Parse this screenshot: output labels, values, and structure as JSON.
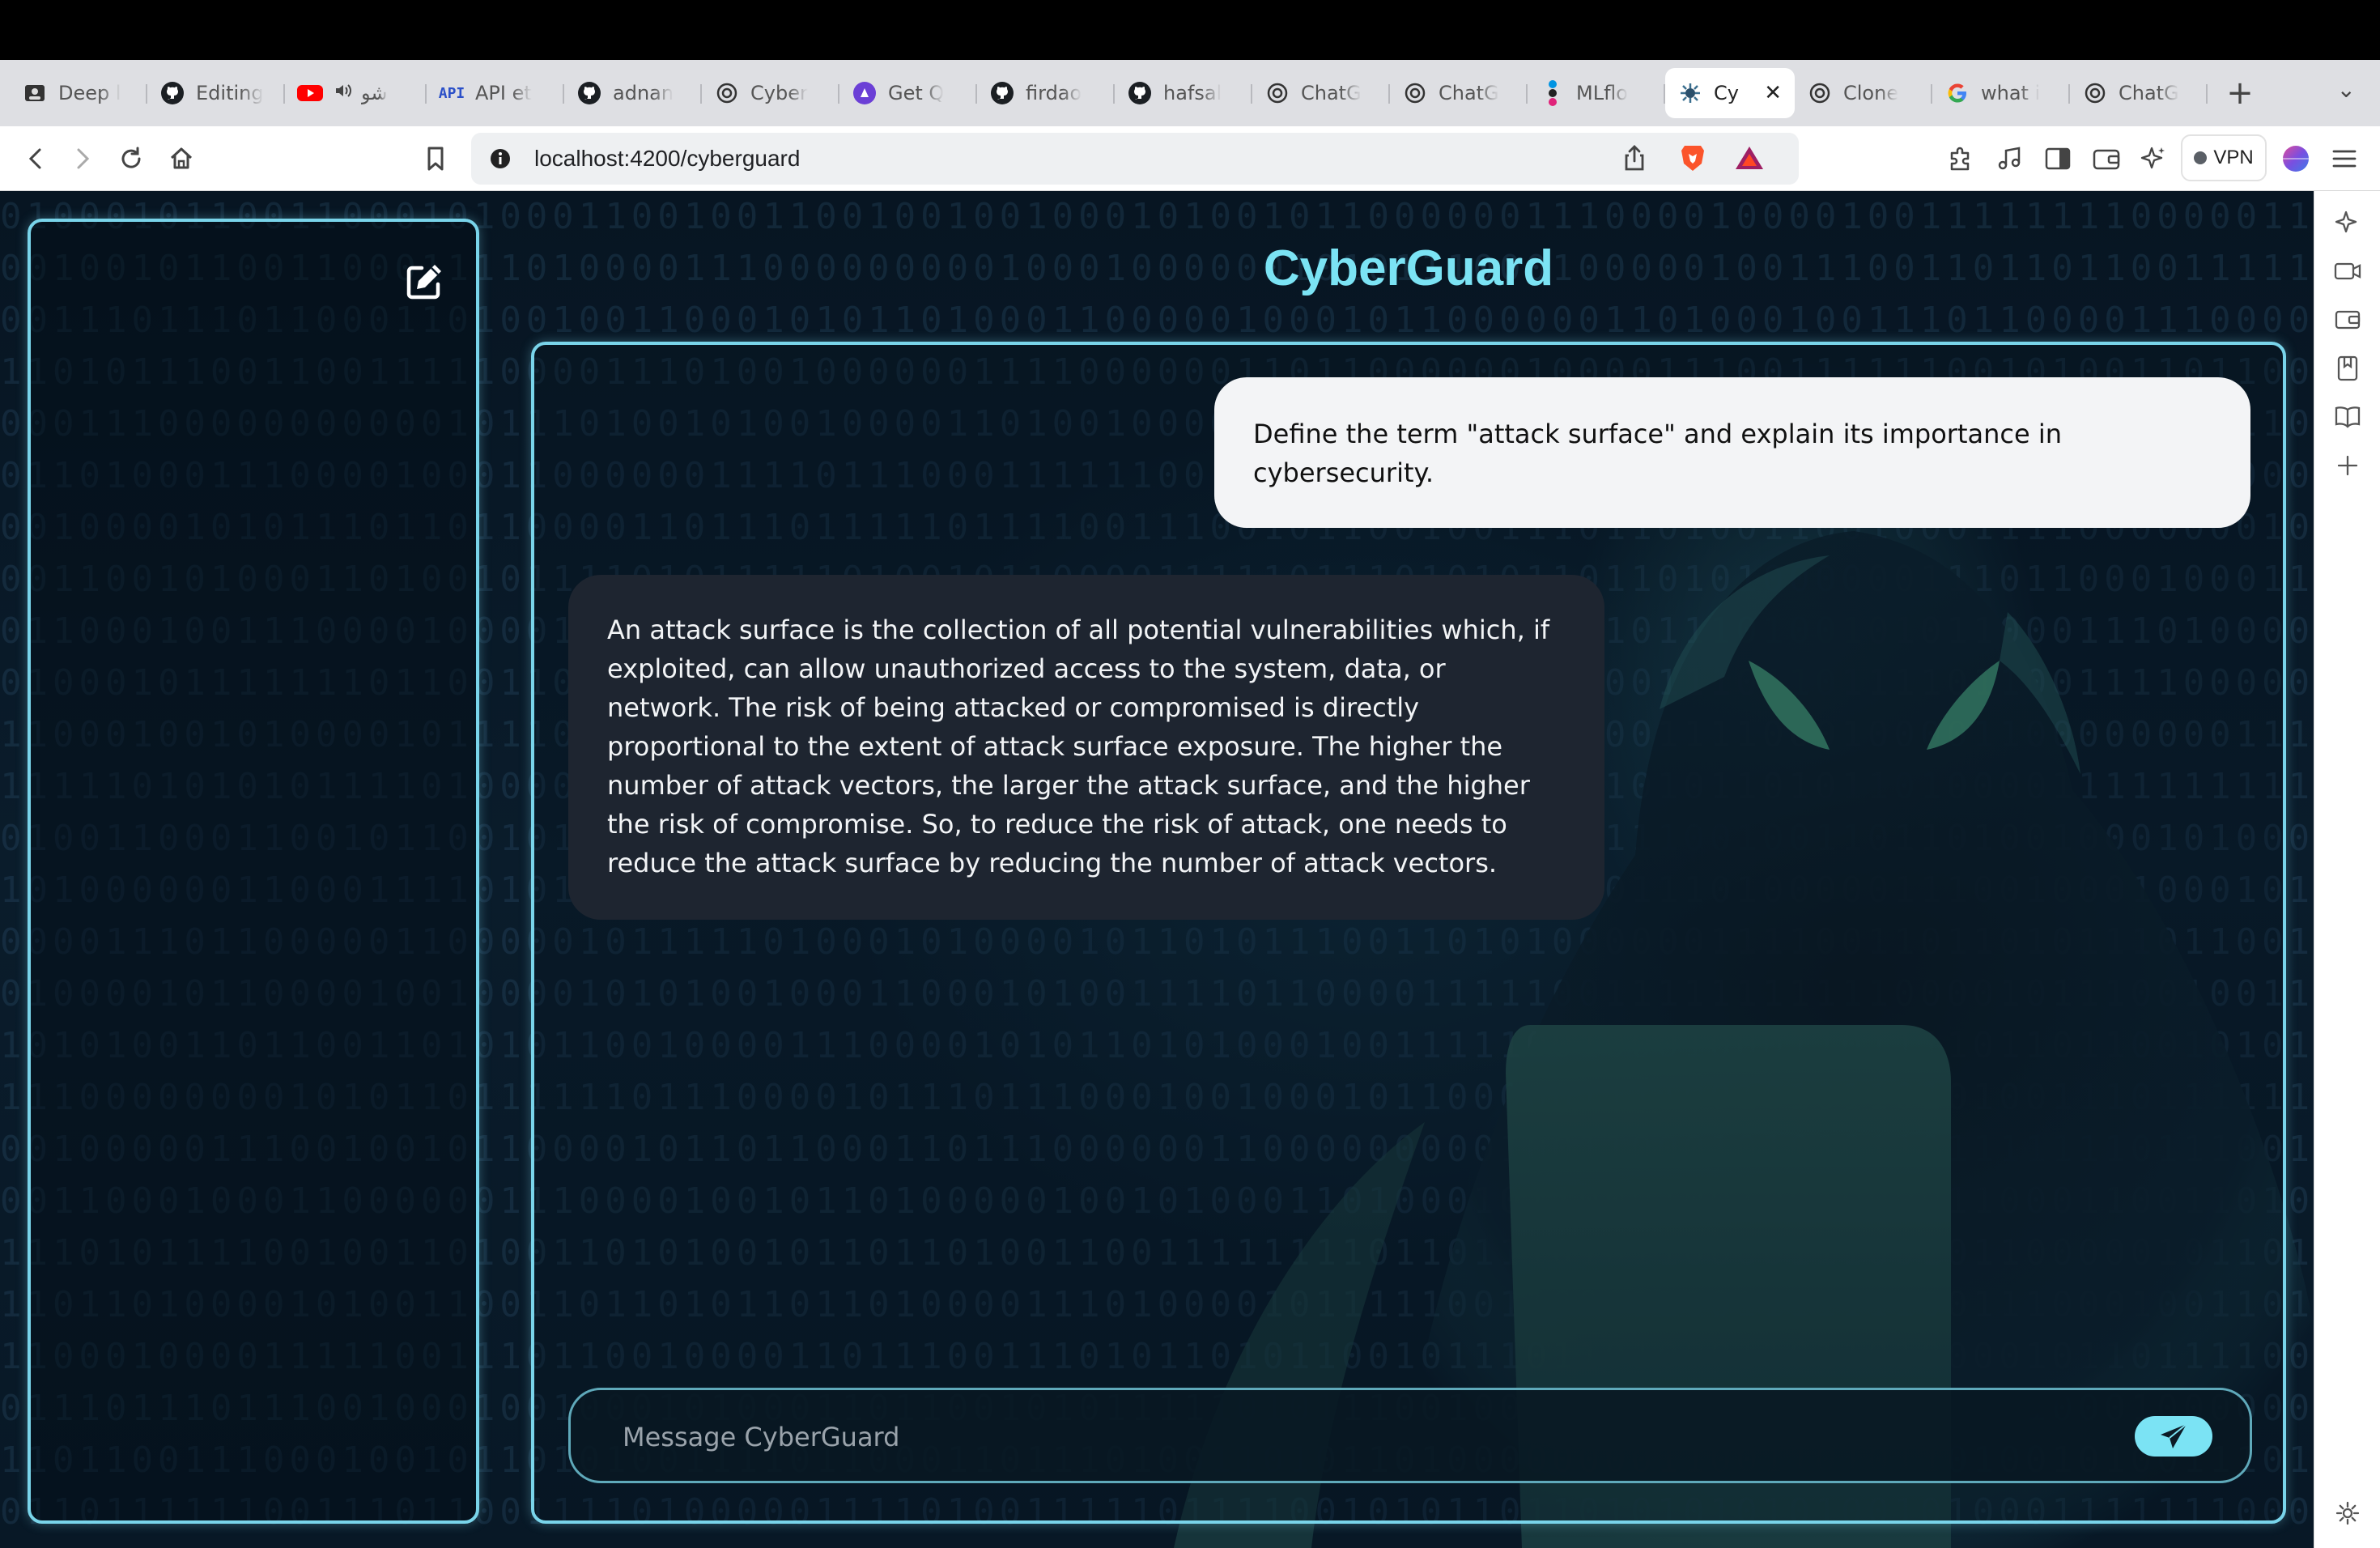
{
  "browser": {
    "tabs": [
      {
        "label": "Deep l",
        "icon": "page-icon"
      },
      {
        "label": "Editing",
        "icon": "github-icon"
      },
      {
        "label": "شو",
        "icon": "youtube-icon"
      },
      {
        "label": "API et",
        "icon": "api-icon"
      },
      {
        "label": "adnan",
        "icon": "github-icon"
      },
      {
        "label": "Cyber",
        "icon": "openai-icon"
      },
      {
        "label": "Get Q",
        "icon": "chat-app-icon"
      },
      {
        "label": "firdao",
        "icon": "github-icon"
      },
      {
        "label": "hafsal",
        "icon": "github-icon"
      },
      {
        "label": "ChatG",
        "icon": "openai-icon"
      },
      {
        "label": "ChatG",
        "icon": "openai-icon"
      },
      {
        "label": "MLflo",
        "icon": "mlflow-icon"
      },
      {
        "label": "Cy",
        "icon": "cyberguard-icon",
        "active": true
      },
      {
        "label": "Clone",
        "icon": "openai-icon"
      },
      {
        "label": "what i",
        "icon": "google-icon"
      },
      {
        "label": "ChatG",
        "icon": "openai-icon"
      }
    ],
    "url": "localhost:4200/cyberguard",
    "vpn_label": "VPN",
    "close_glyph": "✕",
    "new_tab_glyph": "+",
    "tab_menu_glyph": "⌄"
  },
  "app": {
    "title": "CyberGuard",
    "messages": [
      {
        "role": "user",
        "text": "Define the term \"attack surface\" and explain its importance in cybersecurity."
      },
      {
        "role": "assistant",
        "text": "An attack surface is the collection of all potential vulnerabilities which, if exploited, can allow unauthorized access to the system, data, or network. The risk of being attacked or compromised is directly proportional to the extent of attack surface exposure. The higher the number of attack vectors, the larger the attack surface, and the higher the risk of compromise. So, to reduce the risk of attack, one needs to reduce the attack surface by reducing the number of attack vectors."
      }
    ],
    "input": {
      "placeholder": "Message CyberGuard",
      "value": ""
    }
  },
  "colors": {
    "accent": "#7be3f4",
    "panel_border": "#79d4ea",
    "user_bubble": "#f3f4f6",
    "bot_bubble": "#1e2530"
  }
}
